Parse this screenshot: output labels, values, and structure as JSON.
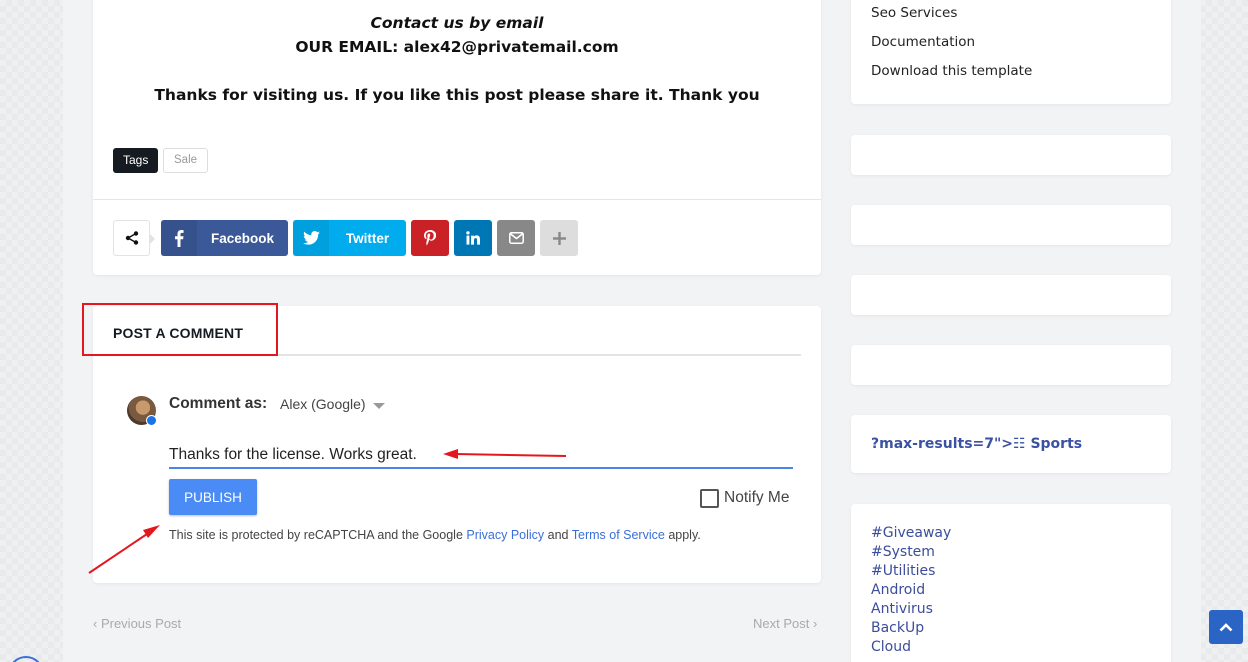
{
  "post": {
    "contact_heading": "Contact us by email",
    "contact_email": "OUR EMAIL: alex42@privatemail.com",
    "thanks": "Thanks for visiting us. If you like this post please share it. Thank you",
    "tags_label": "Tags",
    "tags": [
      "Sale"
    ]
  },
  "share": {
    "facebook": "Facebook",
    "twitter": "Twitter"
  },
  "comment": {
    "title": "POST A COMMENT",
    "comment_as": "Comment as:",
    "identity": "Alex (Google)",
    "input_value": "Thanks for the license. Works great.",
    "publish": "PUBLISH",
    "notify": "Notify Me",
    "recaptcha_prefix": "This site is protected by reCAPTCHA and the Google ",
    "privacy_policy": "Privacy Policy",
    "and": " and ",
    "terms": "Terms of Service",
    "recaptcha_suffix": " apply."
  },
  "post_nav": {
    "prev": "Previous Post",
    "next": "Next Post"
  },
  "sidebar": {
    "links": [
      "Seo Services",
      "Documentation",
      "Download this template"
    ],
    "sports_link": "?max-results=7\">☷ Sports",
    "labels": [
      "#Giveaway",
      "#System",
      "#Utilities",
      "Android",
      "Antivirus",
      "BackUp",
      "Cloud"
    ]
  },
  "colors": {
    "facebook": "#3b5998",
    "twitter": "#00acee",
    "pinterest": "#ca2127",
    "linkedin": "#0077b5",
    "email": "#888888",
    "publish": "#4a8bf5",
    "annotation_red": "#e3181f"
  },
  "icons": {
    "share": "share-icon",
    "facebook": "facebook-icon",
    "twitter": "twitter-icon",
    "pinterest": "pinterest-icon",
    "linkedin": "linkedin-icon",
    "email": "envelope-icon",
    "more": "plus-icon",
    "back_to_top": "chevron-up-icon"
  }
}
